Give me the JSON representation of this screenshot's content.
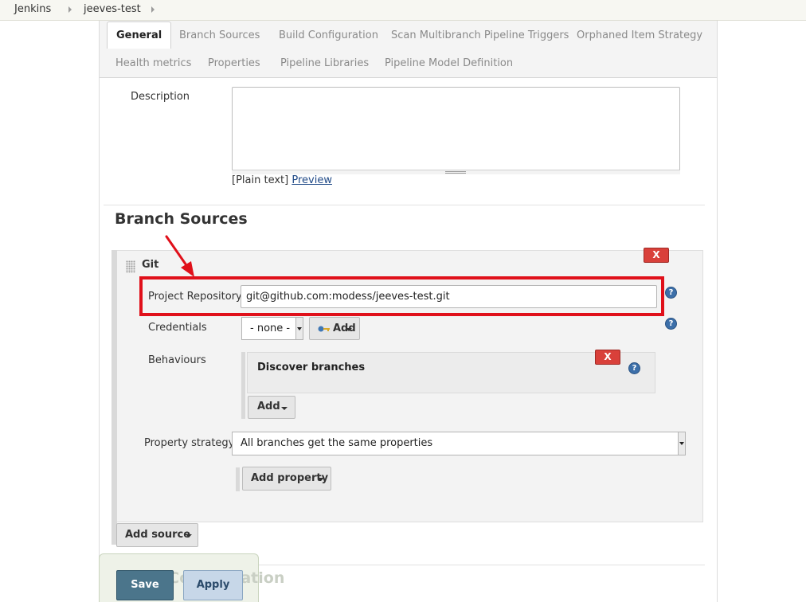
{
  "breadcrumb": {
    "items": [
      "Jenkins",
      "jeeves-test"
    ]
  },
  "tabs": {
    "row1": [
      "General",
      "Branch Sources",
      "Build Configuration",
      "Scan Multibranch Pipeline Triggers",
      "Orphaned Item Strategy"
    ],
    "row2": [
      "Health metrics",
      "Properties",
      "Pipeline Libraries",
      "Pipeline Model Definition"
    ],
    "active": "General"
  },
  "general": {
    "description_label": "Description",
    "description_value": "",
    "plain_text": "[Plain text]",
    "preview_link": "Preview"
  },
  "branch_sources": {
    "title": "Branch Sources",
    "git": {
      "title": "Git",
      "delete_label": "X",
      "project_repository_label": "Project Repository",
      "project_repository_value": "git@github.com:modess/jeeves-test.git",
      "credentials_label": "Credentials",
      "credentials_selected": "- none -",
      "credentials_add_label": "Add",
      "behaviours_label": "Behaviours",
      "behaviours": [
        {
          "title": "Discover branches",
          "delete_label": "X"
        }
      ],
      "behaviours_add_label": "Add",
      "property_strategy_label": "Property strategy",
      "property_strategy_selected": "All branches get the same properties",
      "add_property_label": "Add property",
      "help_icon": "?"
    },
    "add_source_label": "Add source"
  },
  "footer": {
    "partial_heading": "Build Configuration",
    "save_label": "Save",
    "apply_label": "Apply"
  },
  "annotation": {
    "highlight_color": "#e0101a"
  },
  "icons": {
    "credentials_add": "key-icon",
    "help": "help-icon",
    "dropdown": "caret-down-icon",
    "drag": "drag-handle-icon"
  }
}
